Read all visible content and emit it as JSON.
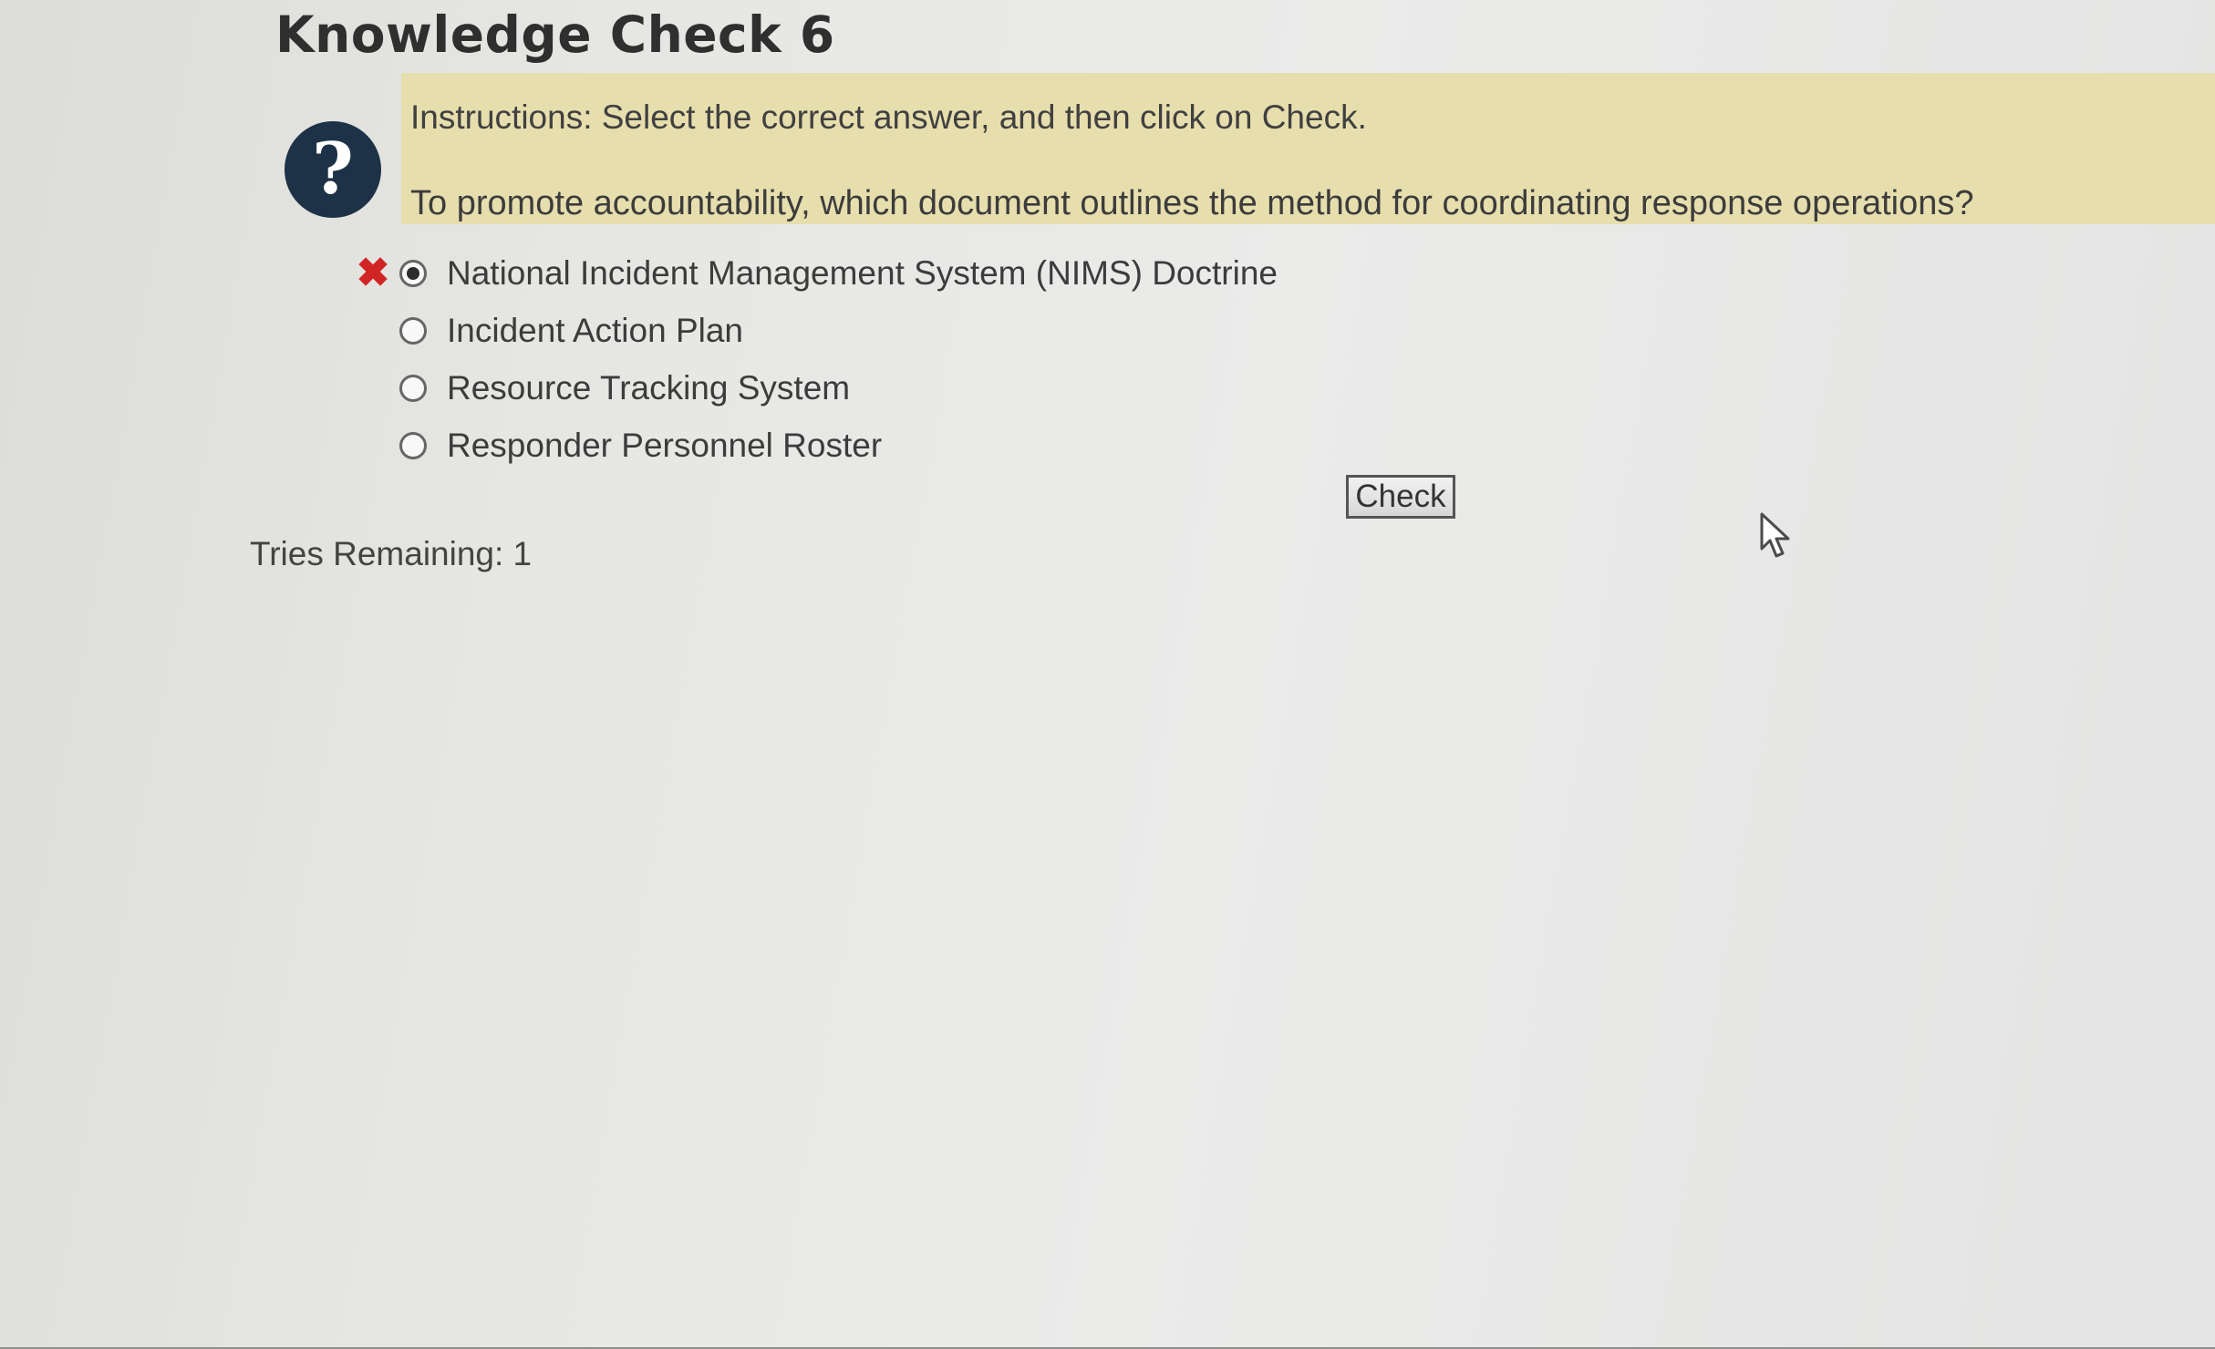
{
  "page": {
    "title": "Knowledge Check 6"
  },
  "question": {
    "help_icon": "question-mark-icon",
    "help_glyph": "?",
    "instructions": "Instructions: Select the correct answer, and then click on Check.",
    "prompt": "To promote accountability, which document outlines the method for coordinating response operations?",
    "panel_color": "#e7deae"
  },
  "options": [
    {
      "label": "National Incident Management System (NIMS) Doctrine",
      "selected": true,
      "result": "incorrect",
      "result_glyph": "✖"
    },
    {
      "label": "Incident Action Plan",
      "selected": false
    },
    {
      "label": "Resource Tracking System",
      "selected": false
    },
    {
      "label": "Responder Personnel Roster",
      "selected": false
    }
  ],
  "actions": {
    "check_label": "Check"
  },
  "status": {
    "tries_remaining": "Tries Remaining: 1"
  },
  "colors": {
    "incorrect_mark": "#d12424",
    "help_icon_bg": "#1d3247"
  }
}
